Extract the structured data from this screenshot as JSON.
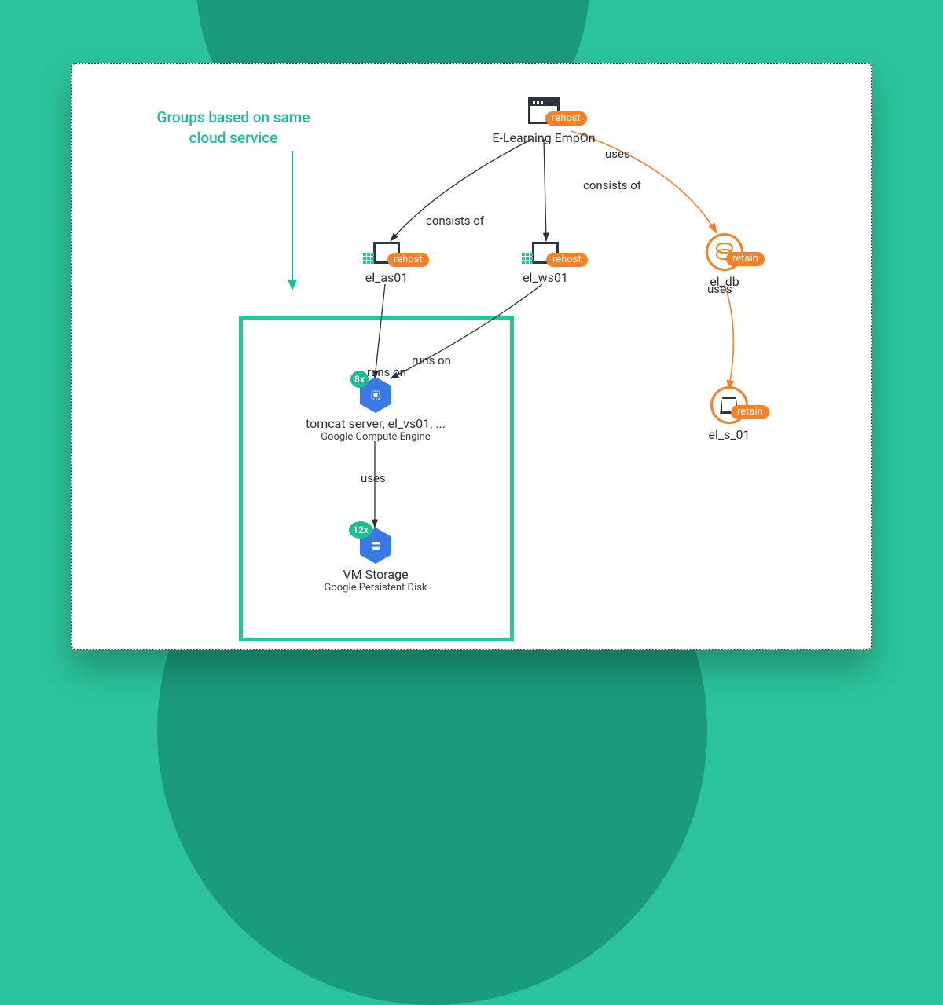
{
  "annotation": {
    "title": "Groups based on same\ncloud service"
  },
  "nodes": {
    "root": {
      "label": "E-Learning EmpOn",
      "action": "rehost"
    },
    "el_as01": {
      "label": "el_as01",
      "action": "rehost"
    },
    "el_ws01": {
      "label": "el_ws01",
      "action": "rehost"
    },
    "el_db": {
      "label": "el_db",
      "action": "retain"
    },
    "compute": {
      "label": "tomcat server, el_vs01, ...",
      "subtitle": "Google Compute Engine",
      "count": "8x"
    },
    "storage_vm": {
      "label": "VM Storage",
      "subtitle": "Google Persistent Disk",
      "count": "12x"
    },
    "el_s_01": {
      "label": "el_s_01",
      "action": "retain"
    }
  },
  "edges": {
    "root_as01": "consists of",
    "root_ws01": "",
    "root_db_uses": "uses",
    "root_db_consists": "consists of",
    "as01_compute": "runs on",
    "ws01_compute": "runs on",
    "compute_storage": "uses",
    "db_s01": "uses"
  },
  "colors": {
    "teal": "#2bc49a",
    "orange": "#f58025"
  }
}
